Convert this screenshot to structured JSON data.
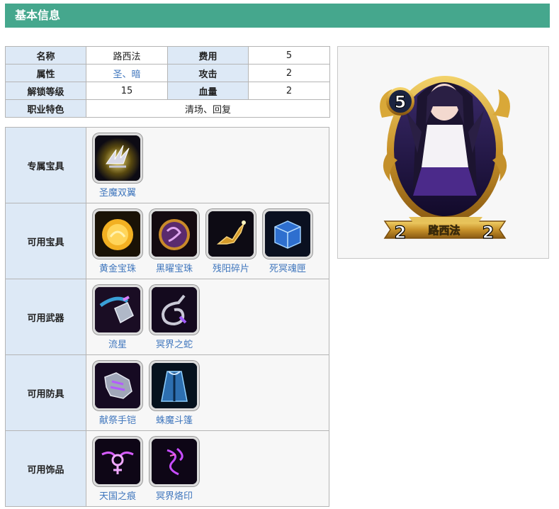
{
  "header": {
    "title": "基本信息"
  },
  "info": {
    "name_label": "名称",
    "name_value": "路西法",
    "cost_label": "费用",
    "cost_value": "5",
    "attr_label": "属性",
    "attr_value_1": "圣",
    "attr_sep": "、",
    "attr_value_2": "暗",
    "attack_label": "攻击",
    "attack_value": "2",
    "unlock_label": "解锁等级",
    "unlock_value": "15",
    "hp_label": "血量",
    "hp_value": "2",
    "trait_label": "职业特色",
    "trait_value": "清场、回复"
  },
  "gear": {
    "exclusive": {
      "label": "专属宝具",
      "items": [
        {
          "name": "圣魔双翼",
          "icon": "wings-icon"
        }
      ]
    },
    "treasures": {
      "label": "可用宝具",
      "items": [
        {
          "name": "黄金宝珠",
          "icon": "golden-orb-icon",
          "color": "#f2b022"
        },
        {
          "name": "黑曜宝珠",
          "icon": "obsidian-orb-icon",
          "color": "#8a3c9e"
        },
        {
          "name": "残阳碎片",
          "icon": "fragment-icon",
          "color": "#d49a2a"
        },
        {
          "name": "死冥魂匣",
          "icon": "soul-box-icon",
          "color": "#3a8ee6"
        }
      ]
    },
    "weapons": {
      "label": "可用武器",
      "items": [
        {
          "name": "流星",
          "icon": "meteor-icon"
        },
        {
          "name": "冥界之蛇",
          "icon": "serpent-whip-icon"
        }
      ]
    },
    "armor": {
      "label": "可用防具",
      "items": [
        {
          "name": "献祭手铠",
          "icon": "gauntlet-icon"
        },
        {
          "name": "蛛魔斗篷",
          "icon": "cloak-icon"
        }
      ]
    },
    "accessories": {
      "label": "可用饰品",
      "items": [
        {
          "name": "天国之痕",
          "icon": "heaven-mark-icon"
        },
        {
          "name": "冥界烙印",
          "icon": "underworld-brand-icon"
        }
      ]
    }
  },
  "card": {
    "name": "路西法",
    "cost": "5",
    "attack": "2",
    "hp": "2",
    "frame_color": "#d4a72e",
    "portrait": "character-portrait"
  }
}
